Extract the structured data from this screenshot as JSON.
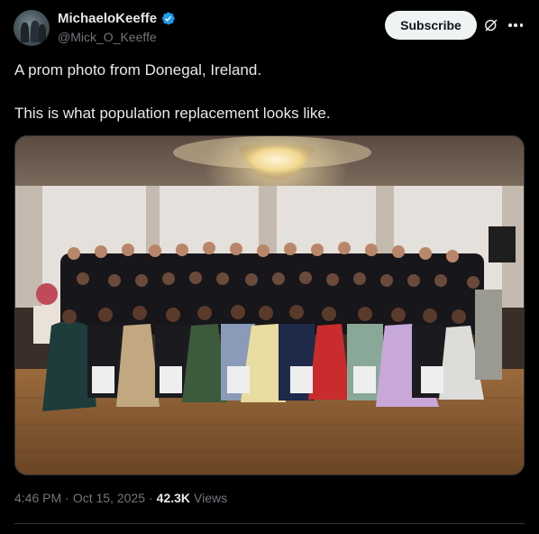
{
  "author": {
    "display_name": "MichaeloKeeffe",
    "handle": "@Mick_O_Keeffe",
    "verified": true,
    "verified_color": "#1d9bf0"
  },
  "actions": {
    "subscribe_label": "Subscribe",
    "grok_icon": "grok-icon",
    "more_icon": "more-icon"
  },
  "tweet": {
    "line1": "A prom photo from Donegal, Ireland.",
    "line2": "This is what population replacement looks like."
  },
  "media": {
    "alt": "Group prom photo"
  },
  "meta": {
    "time": "4:46 PM",
    "sep1": "·",
    "date": "Oct 15, 2025",
    "sep2": "·",
    "views_count": "42.3K",
    "views_label": "Views"
  },
  "colors": {
    "background": "#000000",
    "text": "#e7e9ea",
    "muted": "#71767b",
    "border": "#2f3336"
  }
}
